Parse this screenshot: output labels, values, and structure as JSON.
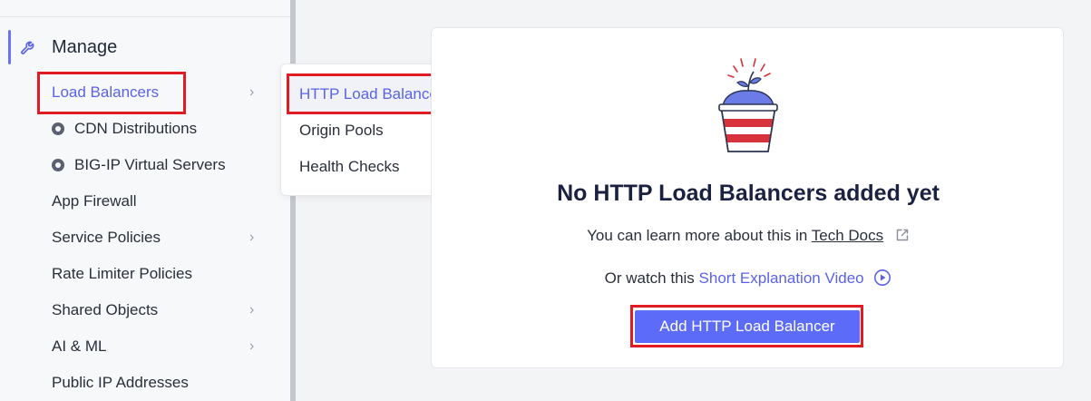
{
  "sidebar": {
    "section": {
      "label": "Manage",
      "icon": "wrench-icon"
    },
    "items": [
      {
        "label": "Load Balancers",
        "chevron": "›",
        "active": true
      },
      {
        "label": "CDN Distributions",
        "icon": "radio-dot-icon"
      },
      {
        "label": "BIG-IP Virtual Servers",
        "icon": "radio-dot-icon"
      },
      {
        "label": "App Firewall"
      },
      {
        "label": "Service Policies",
        "chevron": "›"
      },
      {
        "label": "Rate Limiter Policies"
      },
      {
        "label": "Shared Objects",
        "chevron": "›"
      },
      {
        "label": "AI & ML",
        "chevron": "›"
      },
      {
        "label": "Public IP Addresses"
      }
    ]
  },
  "flyout": {
    "items": [
      {
        "label": "HTTP Load Balancers",
        "active": true
      },
      {
        "label": "Origin Pools"
      },
      {
        "label": "Health Checks"
      }
    ]
  },
  "empty_state": {
    "headline": "No HTTP Load Balancers added yet",
    "learn_prefix": "You can learn more about this in",
    "learn_link": "Tech Docs",
    "watch_prefix": "Or watch this",
    "watch_link": "Short Explanation Video",
    "button_label": "Add HTTP Load Balancer",
    "illustration": "plant-pot-icon"
  },
  "colors": {
    "accent": "#5a63e8",
    "button": "#5c6cf9",
    "highlight_box": "#e01b24",
    "pot_red": "#d8323c",
    "soil_blue": "#6b7be8"
  }
}
